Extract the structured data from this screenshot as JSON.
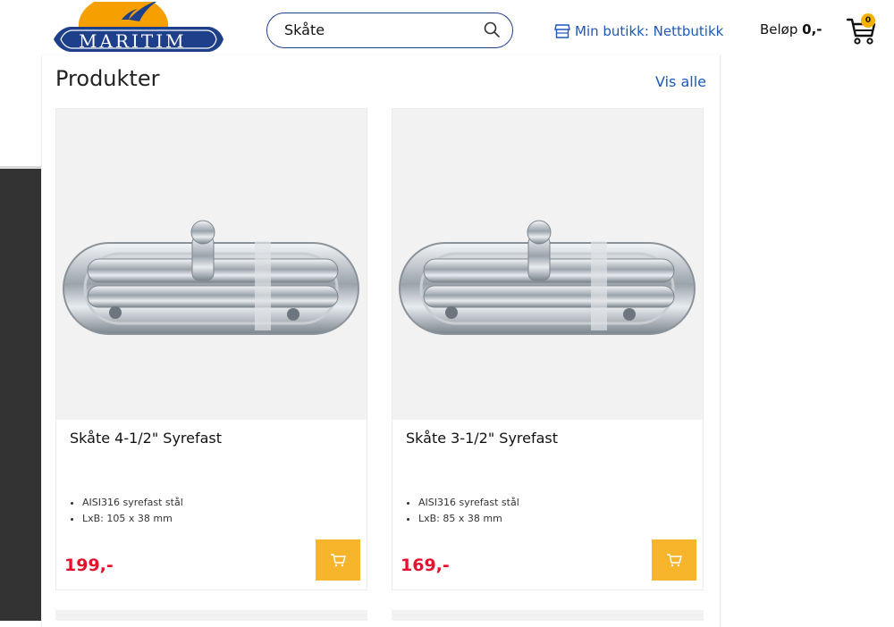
{
  "header": {
    "logo_text": "MARITIM",
    "search_value": "Skåte",
    "store_label": "Min butikk: Nettbutikk",
    "amount_label": "Beløp",
    "amount_value": "0,-",
    "cart_count": "0"
  },
  "section": {
    "title": "Produkter",
    "view_all": "Vis alle"
  },
  "products": [
    {
      "name": "Skåte 4-1/2\" Syrefast",
      "features": [
        "AISI316 syrefast stål",
        "LxB: 105 x 38 mm"
      ],
      "price": "199,-"
    },
    {
      "name": "Skåte 3-1/2\" Syrefast",
      "features": [
        "AISI316 syrefast stål",
        "LxB: 85 x 38 mm"
      ],
      "price": "169,-"
    }
  ],
  "colors": {
    "brand_blue": "#1e3f8a",
    "link_blue": "#1d58b8",
    "price_red": "#e3122d",
    "buy_yellow": "#f7b52c",
    "logo_orange": "#f5a000"
  },
  "icons": [
    "search-icon",
    "store-icon",
    "cart-icon",
    "add-to-cart-icon"
  ]
}
